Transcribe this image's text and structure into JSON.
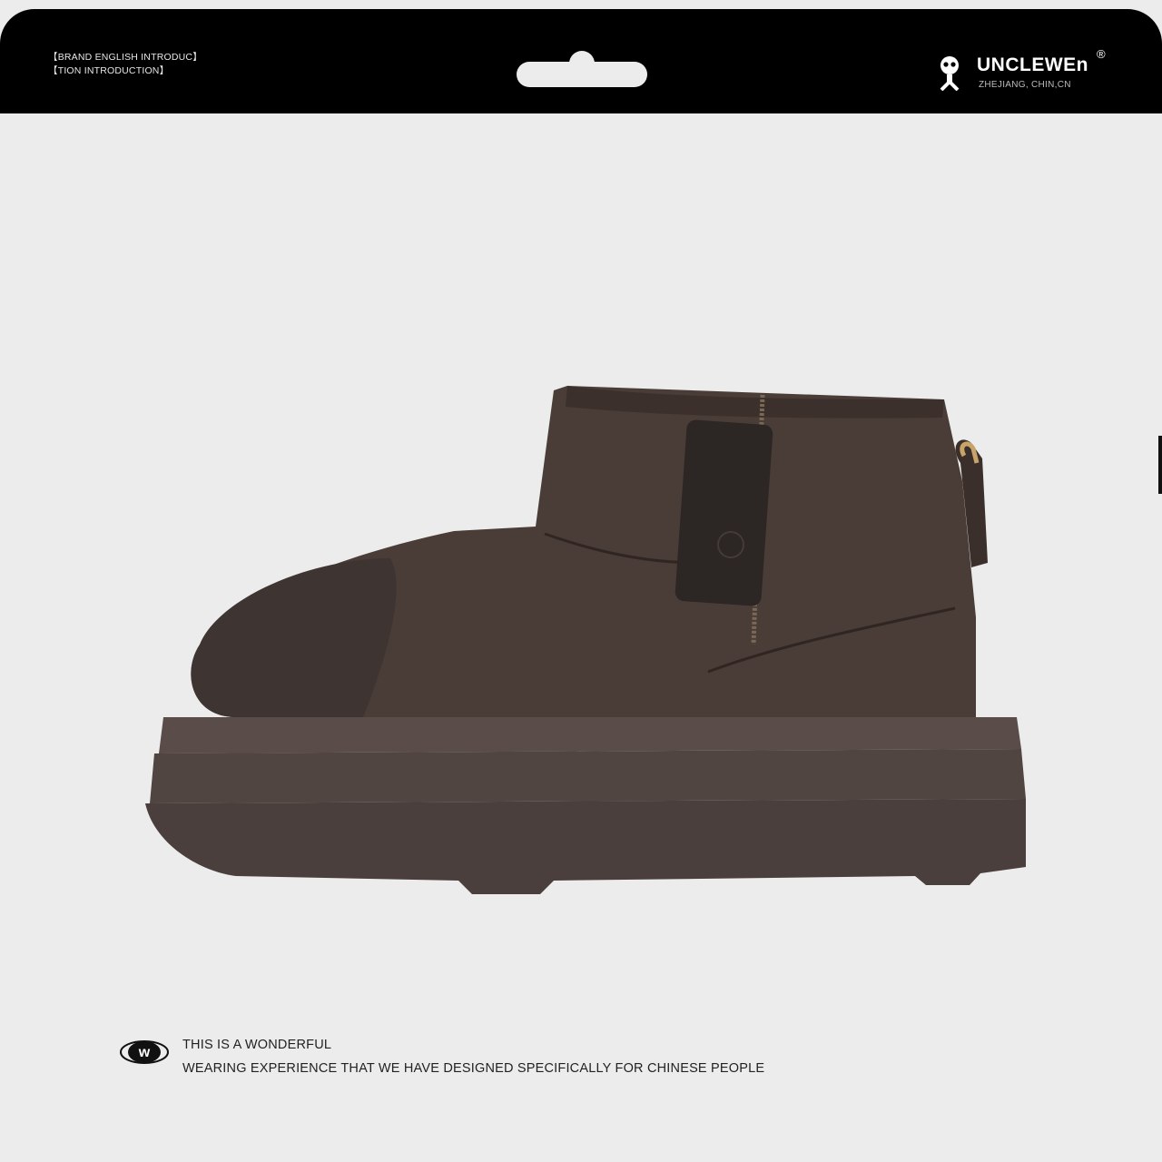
{
  "header": {
    "intro_line1": "【BRAND ENGLISH INTRODUC】",
    "intro_line2": "【TION INTRODUCTION】",
    "brand_name": "UNCLEWEn",
    "brand_reg": "®",
    "brand_location": "ZHEJIANG, CHIN,CN"
  },
  "product": {
    "icon": "ankle-boot-image",
    "colors": {
      "suede": "#4a3c36",
      "sole": "#4f4340",
      "pull_tab": "#c8a46a"
    }
  },
  "footer": {
    "logo_letter": "w",
    "line1": "THIS IS A WONDERFUL",
    "line2": "WEARING EXPERIENCE THAT WE HAVE DESIGNED SPECIFICALLY FOR CHINESE PEOPLE"
  }
}
